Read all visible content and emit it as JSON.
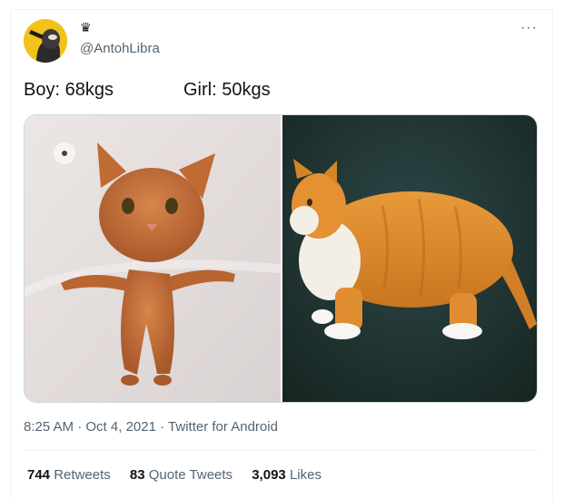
{
  "tweet": {
    "author": {
      "badge_icon": "crown-icon",
      "handle": "@AntohLibra"
    },
    "text_part1": "Boy: 68kgs",
    "text_part2": "Girl: 50kgs",
    "media": [
      {
        "name": "skinny-wet-cat-photo"
      },
      {
        "name": "fat-orange-cat-photo"
      }
    ],
    "time": "8:25 AM",
    "date": "Oct 4, 2021",
    "source": "Twitter for Android",
    "separator": "·",
    "stats": {
      "retweets_count": "744",
      "retweets_label": "Retweets",
      "quotes_count": "83",
      "quotes_label": "Quote Tweets",
      "likes_count": "3,093",
      "likes_label": "Likes"
    },
    "more_label": "···"
  },
  "colors": {
    "text": "#0f1419",
    "secondary": "#536471",
    "border": "#eff3f4",
    "avatar_bg": "#f0c419"
  }
}
